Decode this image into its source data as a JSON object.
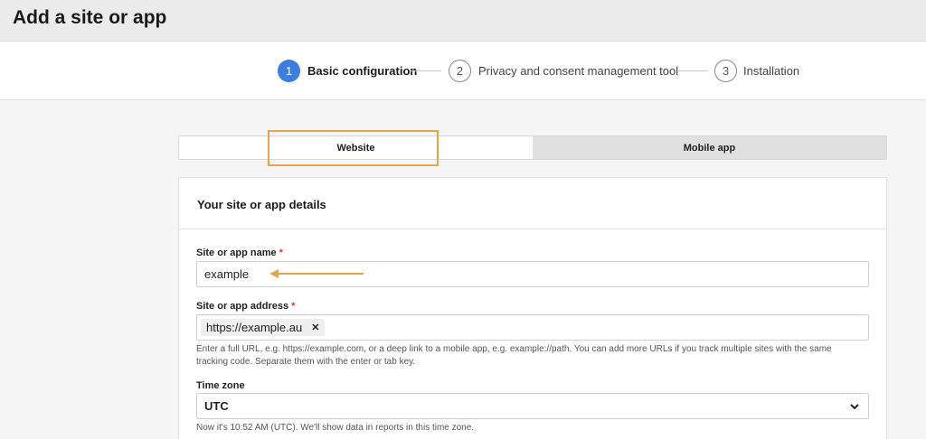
{
  "page": {
    "title": "Add a site or app"
  },
  "stepper": {
    "steps": [
      {
        "number": "1",
        "label": "Basic configuration"
      },
      {
        "number": "2",
        "label": "Privacy and consent management tool"
      },
      {
        "number": "3",
        "label": "Installation"
      }
    ]
  },
  "type_toggle": {
    "options": [
      "Website",
      "Mobile app"
    ],
    "selected": "Website"
  },
  "form": {
    "section_title": "Your site or app details",
    "name": {
      "label": "Site or app name",
      "required_mark": "*",
      "value": "example"
    },
    "address": {
      "label": "Site or app address",
      "required_mark": "*",
      "chips": [
        "https://example.au"
      ],
      "help_line1": "Enter a full URL, e.g. https://example.com, or a deep link to a mobile app, e.g. example://path. You can add more URLs if you track multiple sites with the same",
      "help_line2": "tracking code. Separate them with the enter or tab key."
    },
    "timezone": {
      "label": "Time zone",
      "value": "UTC",
      "help": "Now it's 10:52 AM (UTC). We'll show data in reports in this time zone."
    }
  },
  "colors": {
    "accent": "#3b7ee0",
    "highlight": "#e4a64c",
    "required": "#dd3333"
  }
}
